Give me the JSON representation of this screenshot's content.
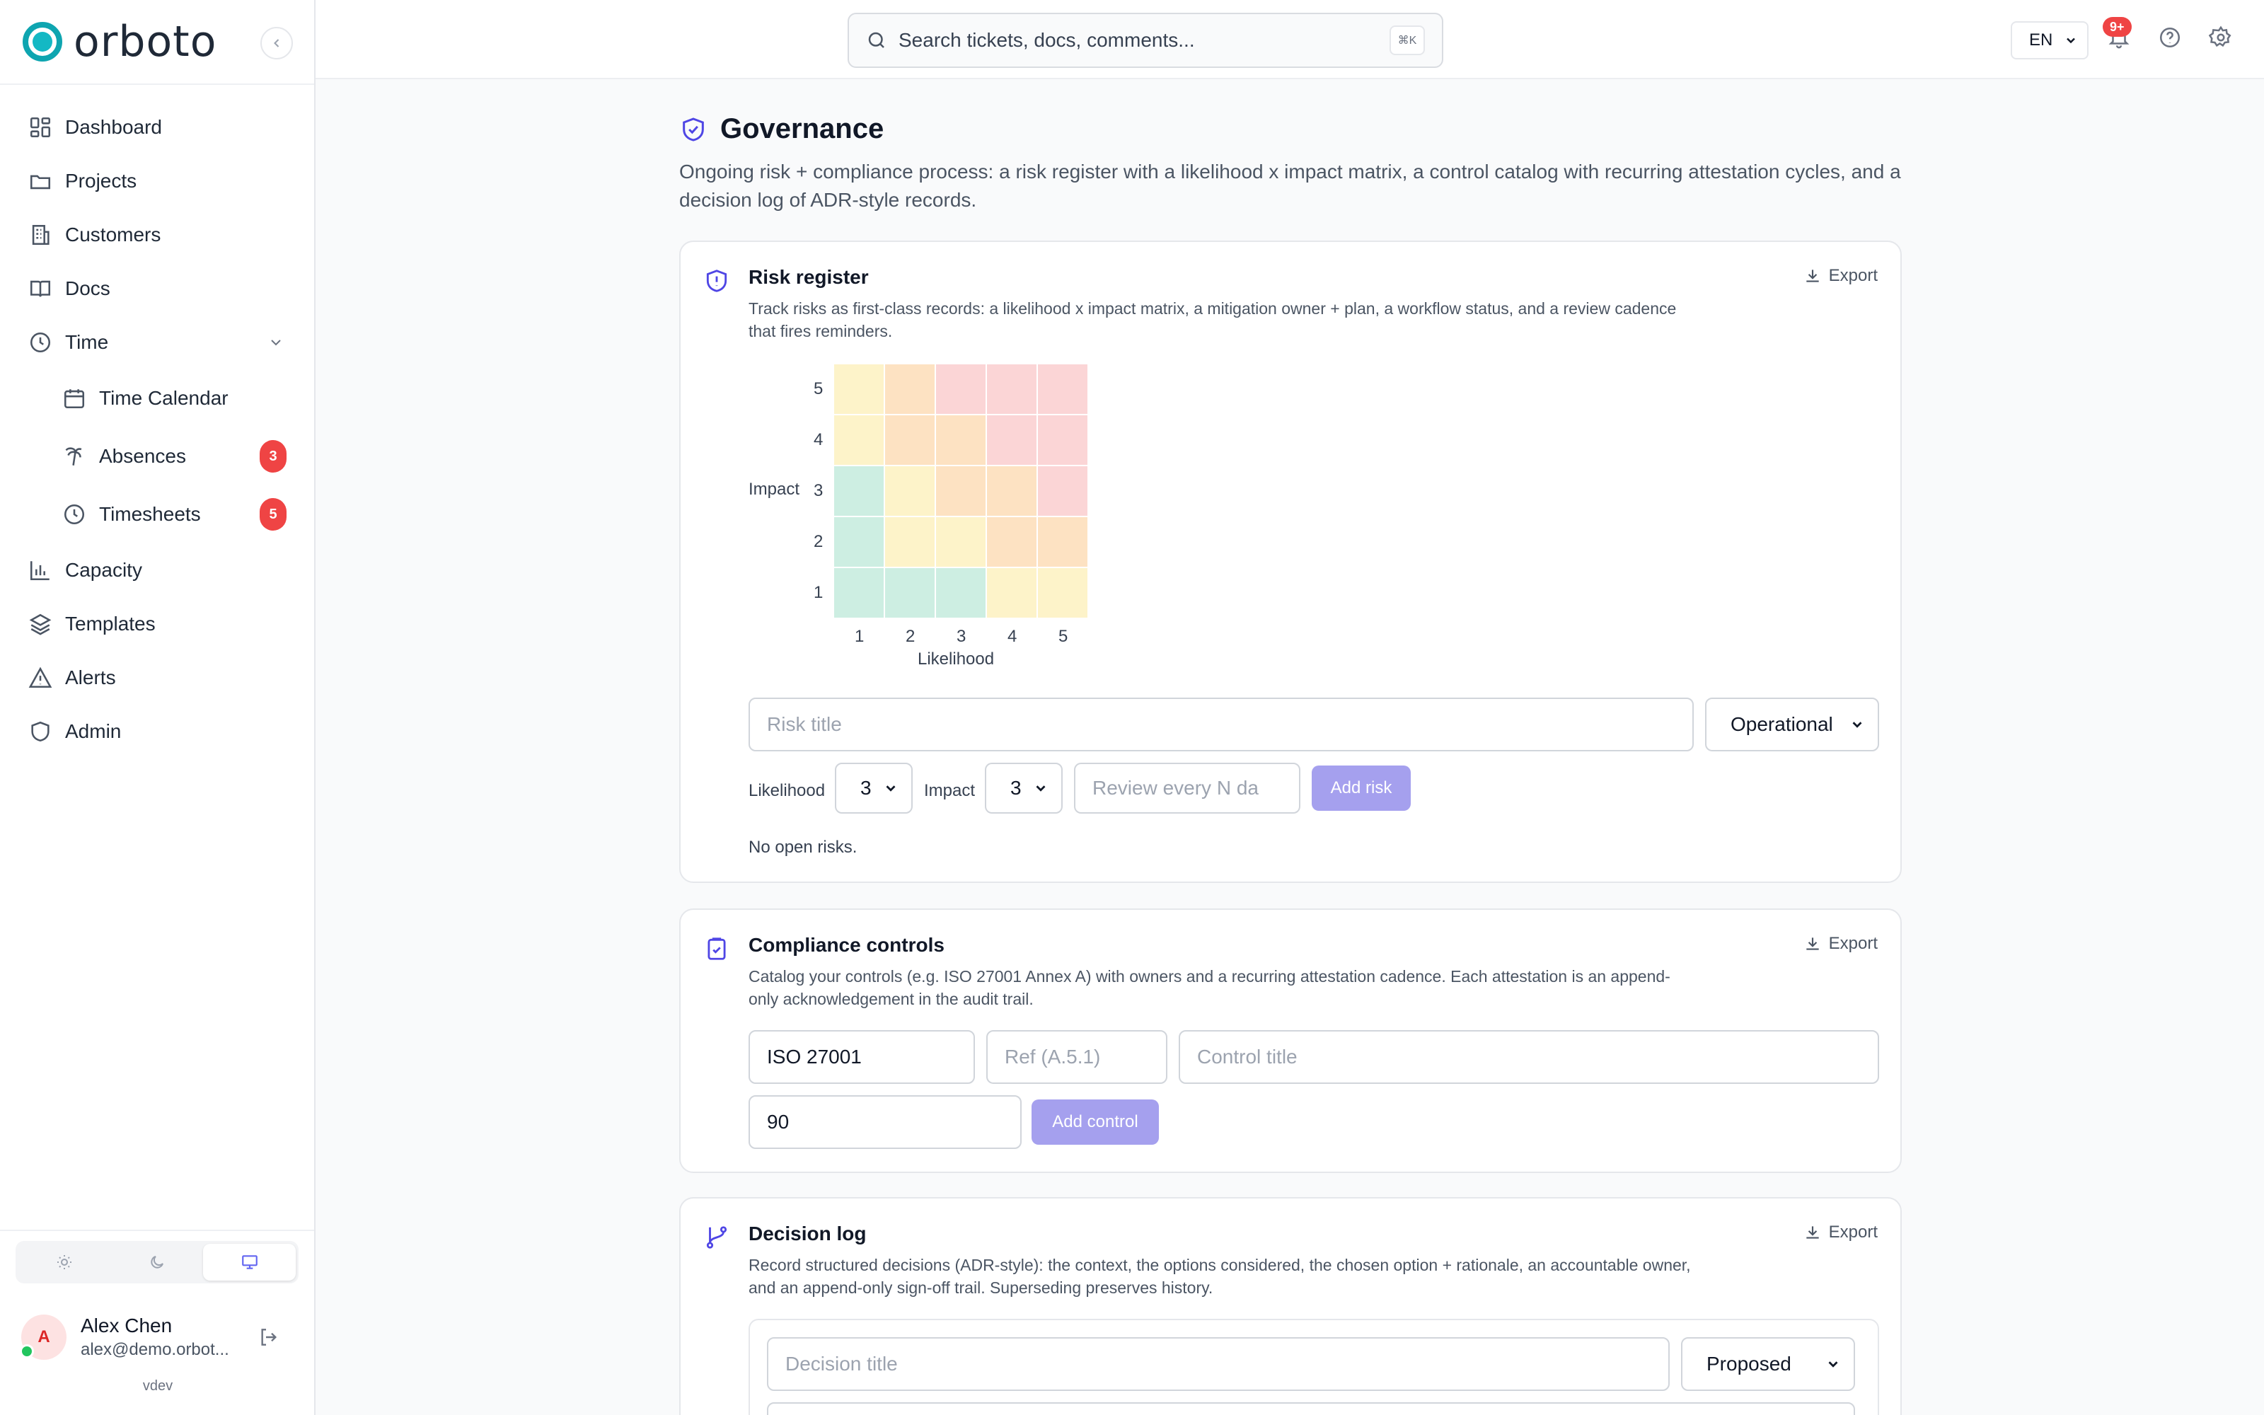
{
  "app": {
    "logo_text": "orboto",
    "version": "vdev"
  },
  "sidebar": {
    "items": [
      {
        "label": "Dashboard",
        "icon": "dashboard-icon"
      },
      {
        "label": "Projects",
        "icon": "folder-icon"
      },
      {
        "label": "Customers",
        "icon": "building-icon"
      },
      {
        "label": "Docs",
        "icon": "book-icon"
      },
      {
        "label": "Time",
        "icon": "clock-icon",
        "expanded": true
      },
      {
        "label": "Time Calendar",
        "icon": "calendar-icon"
      },
      {
        "label": "Absences",
        "icon": "palm-tree-icon",
        "badge": "3"
      },
      {
        "label": "Timesheets",
        "icon": "clock-icon",
        "badge": "5"
      },
      {
        "label": "Capacity",
        "icon": "bar-chart-icon"
      },
      {
        "label": "Templates",
        "icon": "layers-icon"
      },
      {
        "label": "Alerts",
        "icon": "warning-icon"
      },
      {
        "label": "Admin",
        "icon": "shield-icon"
      }
    ],
    "theme_options": [
      "light",
      "dark",
      "system"
    ],
    "theme_selected": "system"
  },
  "user": {
    "initial": "A",
    "name": "Alex Chen",
    "email": "alex@demo.orbot..."
  },
  "topbar": {
    "search_placeholder": "Search tickets, docs, comments...",
    "search_shortcut": "⌘K",
    "language": "EN",
    "notifications_badge": "9+"
  },
  "page": {
    "title": "Governance",
    "description": "Ongoing risk + compliance process: a risk register with a likelihood x impact matrix, a control catalog with recurring attestation cycles, and a decision log of ADR-style records."
  },
  "risk_register": {
    "title": "Risk register",
    "description": "Track risks as first-class records: a likelihood x impact matrix, a mitigation owner + plan, a workflow status, and a review cadence that fires reminders.",
    "export_label": "Export",
    "matrix": {
      "y_label": "Impact",
      "x_label": "Likelihood",
      "impact_ticks": [
        "5",
        "4",
        "3",
        "2",
        "1"
      ],
      "likelihood_ticks": [
        "1",
        "2",
        "3",
        "4",
        "5"
      ],
      "colors": {
        "low": "#cdeee2",
        "medium_low": "#fdf3c9",
        "medium": "#fde2c2",
        "high": "#fbd5d6"
      },
      "rows": [
        [
          "medium_low",
          "medium",
          "high",
          "high",
          "high"
        ],
        [
          "medium_low",
          "medium",
          "medium",
          "high",
          "high"
        ],
        [
          "low",
          "medium_low",
          "medium",
          "medium",
          "high"
        ],
        [
          "low",
          "medium_low",
          "medium_low",
          "medium",
          "medium"
        ],
        [
          "low",
          "low",
          "low",
          "medium_low",
          "medium_low"
        ]
      ]
    },
    "form": {
      "title_placeholder": "Risk title",
      "category": "Operational",
      "likelihood_label": "Likelihood",
      "likelihood_value": "3",
      "impact_label": "Impact",
      "impact_value": "3",
      "review_placeholder": "Review every N da",
      "add_label": "Add risk"
    },
    "empty_text": "No open risks."
  },
  "controls": {
    "title": "Compliance controls",
    "description": "Catalog your controls (e.g. ISO 27001 Annex A) with owners and a recurring attestation cadence. Each attestation is an append-only acknowledgement in the audit trail.",
    "export_label": "Export",
    "form": {
      "framework_value": "ISO 27001",
      "ref_placeholder": "Ref (A.5.1)",
      "title_placeholder": "Control title",
      "cadence_value": "90",
      "add_label": "Add control"
    }
  },
  "decision_log": {
    "title": "Decision log",
    "description": "Record structured decisions (ADR-style): the context, the options considered, the chosen option + rationale, an accountable owner, and an append-only sign-off trail. Superseding preserves history.",
    "export_label": "Export",
    "form": {
      "title_placeholder": "Decision title",
      "status": "Proposed"
    }
  }
}
